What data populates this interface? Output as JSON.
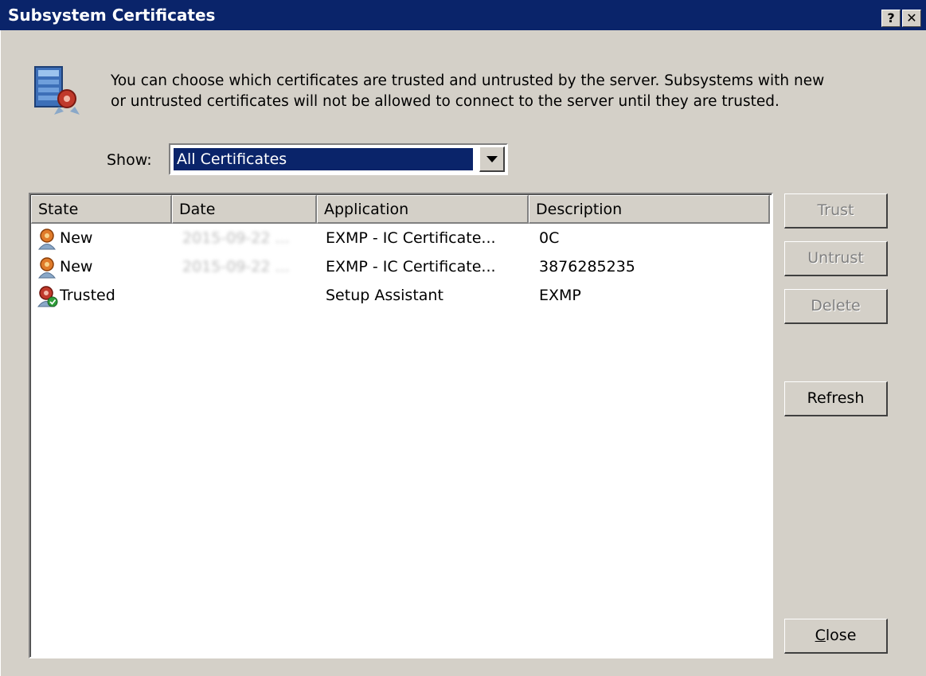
{
  "window": {
    "title": "Subsystem Certificates",
    "help_label": "?",
    "close_label": "✕"
  },
  "description": {
    "line1": "You can choose which certificates are trusted and untrusted by the server. Subsystems with new",
    "line2": "or untrusted certificates will not be allowed to connect to the server until they are trusted."
  },
  "filter": {
    "label": "Show:",
    "selected": "All Certificates"
  },
  "table": {
    "columns": [
      "State",
      "Date",
      "Application",
      "Description"
    ],
    "rows": [
      {
        "state": "New",
        "date": "2015-09-22 ...",
        "application": "EXMP - IC Certificate...",
        "description": "0C",
        "icon": "certificate-new-icon"
      },
      {
        "state": "New",
        "date": "2015-09-22 ...",
        "application": "EXMP - IC Certificate...",
        "description": "3876285235",
        "icon": "certificate-new-icon"
      },
      {
        "state": "Trusted",
        "date": "",
        "application": "Setup Assistant",
        "description": "EXMP",
        "icon": "certificate-trusted-icon"
      }
    ]
  },
  "buttons": {
    "trust": "Trust",
    "untrust": "Untrust",
    "delete": "Delete",
    "refresh": "Refresh",
    "close_first": "C",
    "close_rest": "lose"
  },
  "colors": {
    "title_bar": "#0a246a",
    "dialog_bg": "#d4d0c8",
    "selection": "#0a246a"
  }
}
